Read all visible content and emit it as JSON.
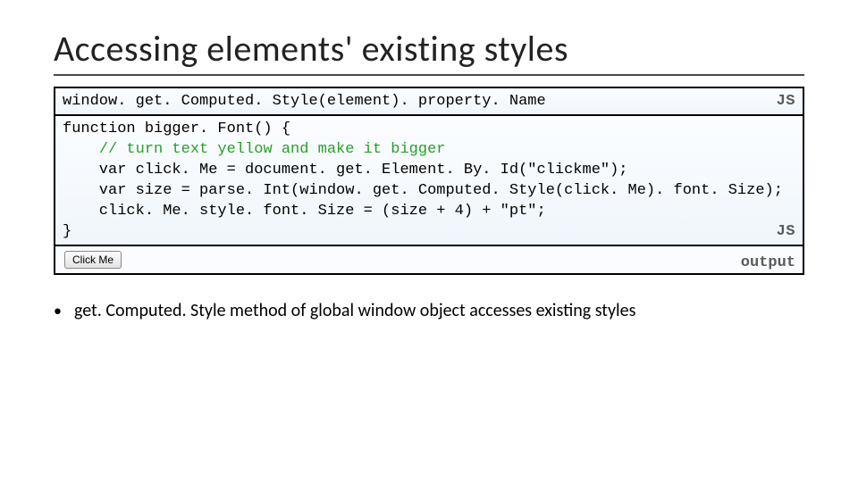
{
  "title": "Accessing elements' existing styles",
  "box1": {
    "code": "window. get. Computed. Style(element). property. Name",
    "lang": "JS"
  },
  "box2": {
    "line1": "function bigger. Font() {",
    "line2_indent": "    ",
    "line2_comment": "// turn text yellow and make it bigger",
    "line3": "    var click. Me = document. get. Element. By. Id(\"clickme\");",
    "line4": "    var size = parse. Int(window. get. Computed. Style(click. Me). font. Size);",
    "line5": "    click. Me. style. font. Size = (size + 4) + \"pt\";",
    "line6": "}",
    "lang": "JS"
  },
  "output": {
    "button_label": "Click Me",
    "lang": "output"
  },
  "bullet": "get. Computed. Style method of global window object accesses existing styles"
}
